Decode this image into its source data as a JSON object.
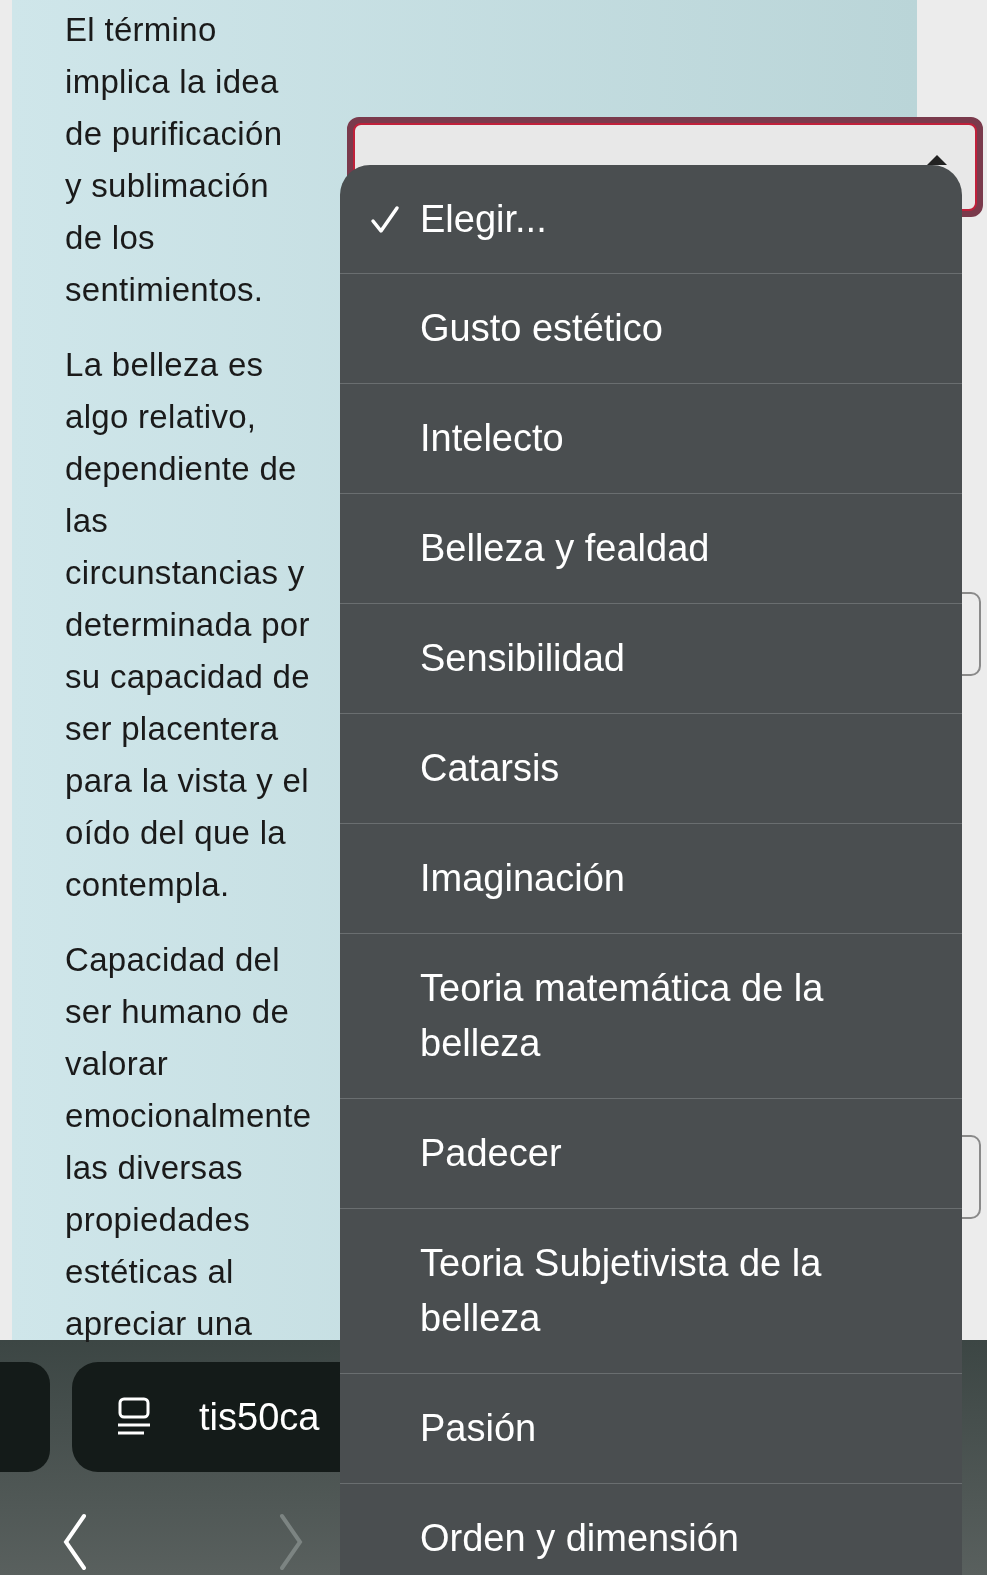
{
  "paragraphs": [
    {
      "lines": [
        "El término",
        "implica la idea",
        "de purificación",
        "y sublimación",
        "de los",
        "sentimientos."
      ]
    },
    {
      "lines": [
        "La belleza es",
        "algo relativo,",
        "dependiente de",
        "las",
        "circunstancias y",
        "determinada por",
        "su capacidad de",
        "ser placentera",
        "para la vista y el",
        "oído del que la",
        "contempla."
      ]
    },
    {
      "lines": [
        "Capacidad del",
        "ser humano de",
        "valorar",
        "emocionalmente",
        "las diversas",
        "propiedades",
        "estéticas al",
        "apreciar una"
      ]
    }
  ],
  "select": {
    "open": true
  },
  "menu": [
    {
      "label": "Elegir...",
      "checked": true
    },
    {
      "label": "Gusto estético",
      "checked": false
    },
    {
      "label": "Intelecto",
      "checked": false
    },
    {
      "label": "Belleza y fealdad",
      "checked": false
    },
    {
      "label": "Sensibilidad",
      "checked": false
    },
    {
      "label": "Catarsis",
      "checked": false
    },
    {
      "label": "Imaginación",
      "checked": false
    },
    {
      "label": "Teoria matemática de la belleza",
      "checked": false
    },
    {
      "label": "Padecer",
      "checked": false
    },
    {
      "label": "Teoria Subjetivista de la belleza",
      "checked": false
    },
    {
      "label": "Pasión",
      "checked": false
    },
    {
      "label": "Orden y dimensión",
      "checked": false
    }
  ],
  "browser_bar": {
    "address": "tis50ca",
    "back": {
      "disabled": false
    },
    "forward": {
      "disabled": true
    }
  }
}
